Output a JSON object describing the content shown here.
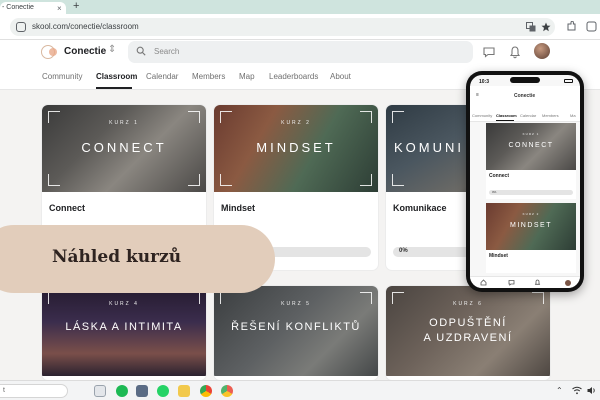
{
  "browser": {
    "tab_title": "- Conectie",
    "close_glyph": "×",
    "new_tab_glyph": "+",
    "url": "skool.com/conectie/classroom",
    "icons": [
      "translate-icon",
      "star-icon",
      "extensions-icon",
      "profile-icon"
    ]
  },
  "header": {
    "group_name": "Conectie",
    "switch_glyph": "⇕",
    "search_placeholder": "Search",
    "icons": [
      "chat-icon",
      "bell-icon",
      "avatar"
    ]
  },
  "nav": {
    "tabs": [
      "Community",
      "Classroom",
      "Calendar",
      "Members",
      "Map",
      "Leaderboards",
      "About"
    ],
    "active": "Classroom"
  },
  "courses": [
    {
      "kurz": "KURZ 1",
      "name": "CONNECT",
      "title": "Connect",
      "progress": null
    },
    {
      "kurz": "KURZ 2",
      "name": "MINDSET",
      "title": "Mindset",
      "progress": null
    },
    {
      "kurz": "",
      "name": "KOMUNI",
      "title": "Komunikace",
      "progress_label": "0%"
    },
    {
      "kurz": "KURZ 4",
      "name": "LÁSKA A INTIMITA"
    },
    {
      "kurz": "KURZ 5",
      "name": "ŘEŠENÍ KONFLIKTŮ"
    },
    {
      "kurz": "KURZ 6",
      "name": "ODPUŠTĚNÍ",
      "name2": "A UZDRAVENÍ"
    }
  ],
  "overlay": {
    "label": "Náhled kurzů"
  },
  "phone": {
    "time": "10:3",
    "menu_glyph": "≡",
    "group_name": "Conectie",
    "tabs": [
      "Community",
      "Classroom",
      "Calendar",
      "Members",
      "Ma"
    ],
    "card1_title": "Connect",
    "card1_kurz": "KURZ 1",
    "card1_name": "CONNECT",
    "card1_progress": "0%",
    "card2_kurz": "KURZ 2",
    "card2_name": "MINDSET",
    "card2_title": "Mindset"
  },
  "taskbar": {
    "search_text": "t",
    "icons": [
      "files-icon",
      "store-icon",
      "spotify-icon",
      "camera-icon",
      "whatsapp-icon",
      "folder-icon",
      "chrome-icon",
      "chrome-dev-icon"
    ]
  },
  "colors": {
    "pill": "#e2cdbb",
    "accent": "#202124",
    "tabbar": "#cfe4de"
  }
}
